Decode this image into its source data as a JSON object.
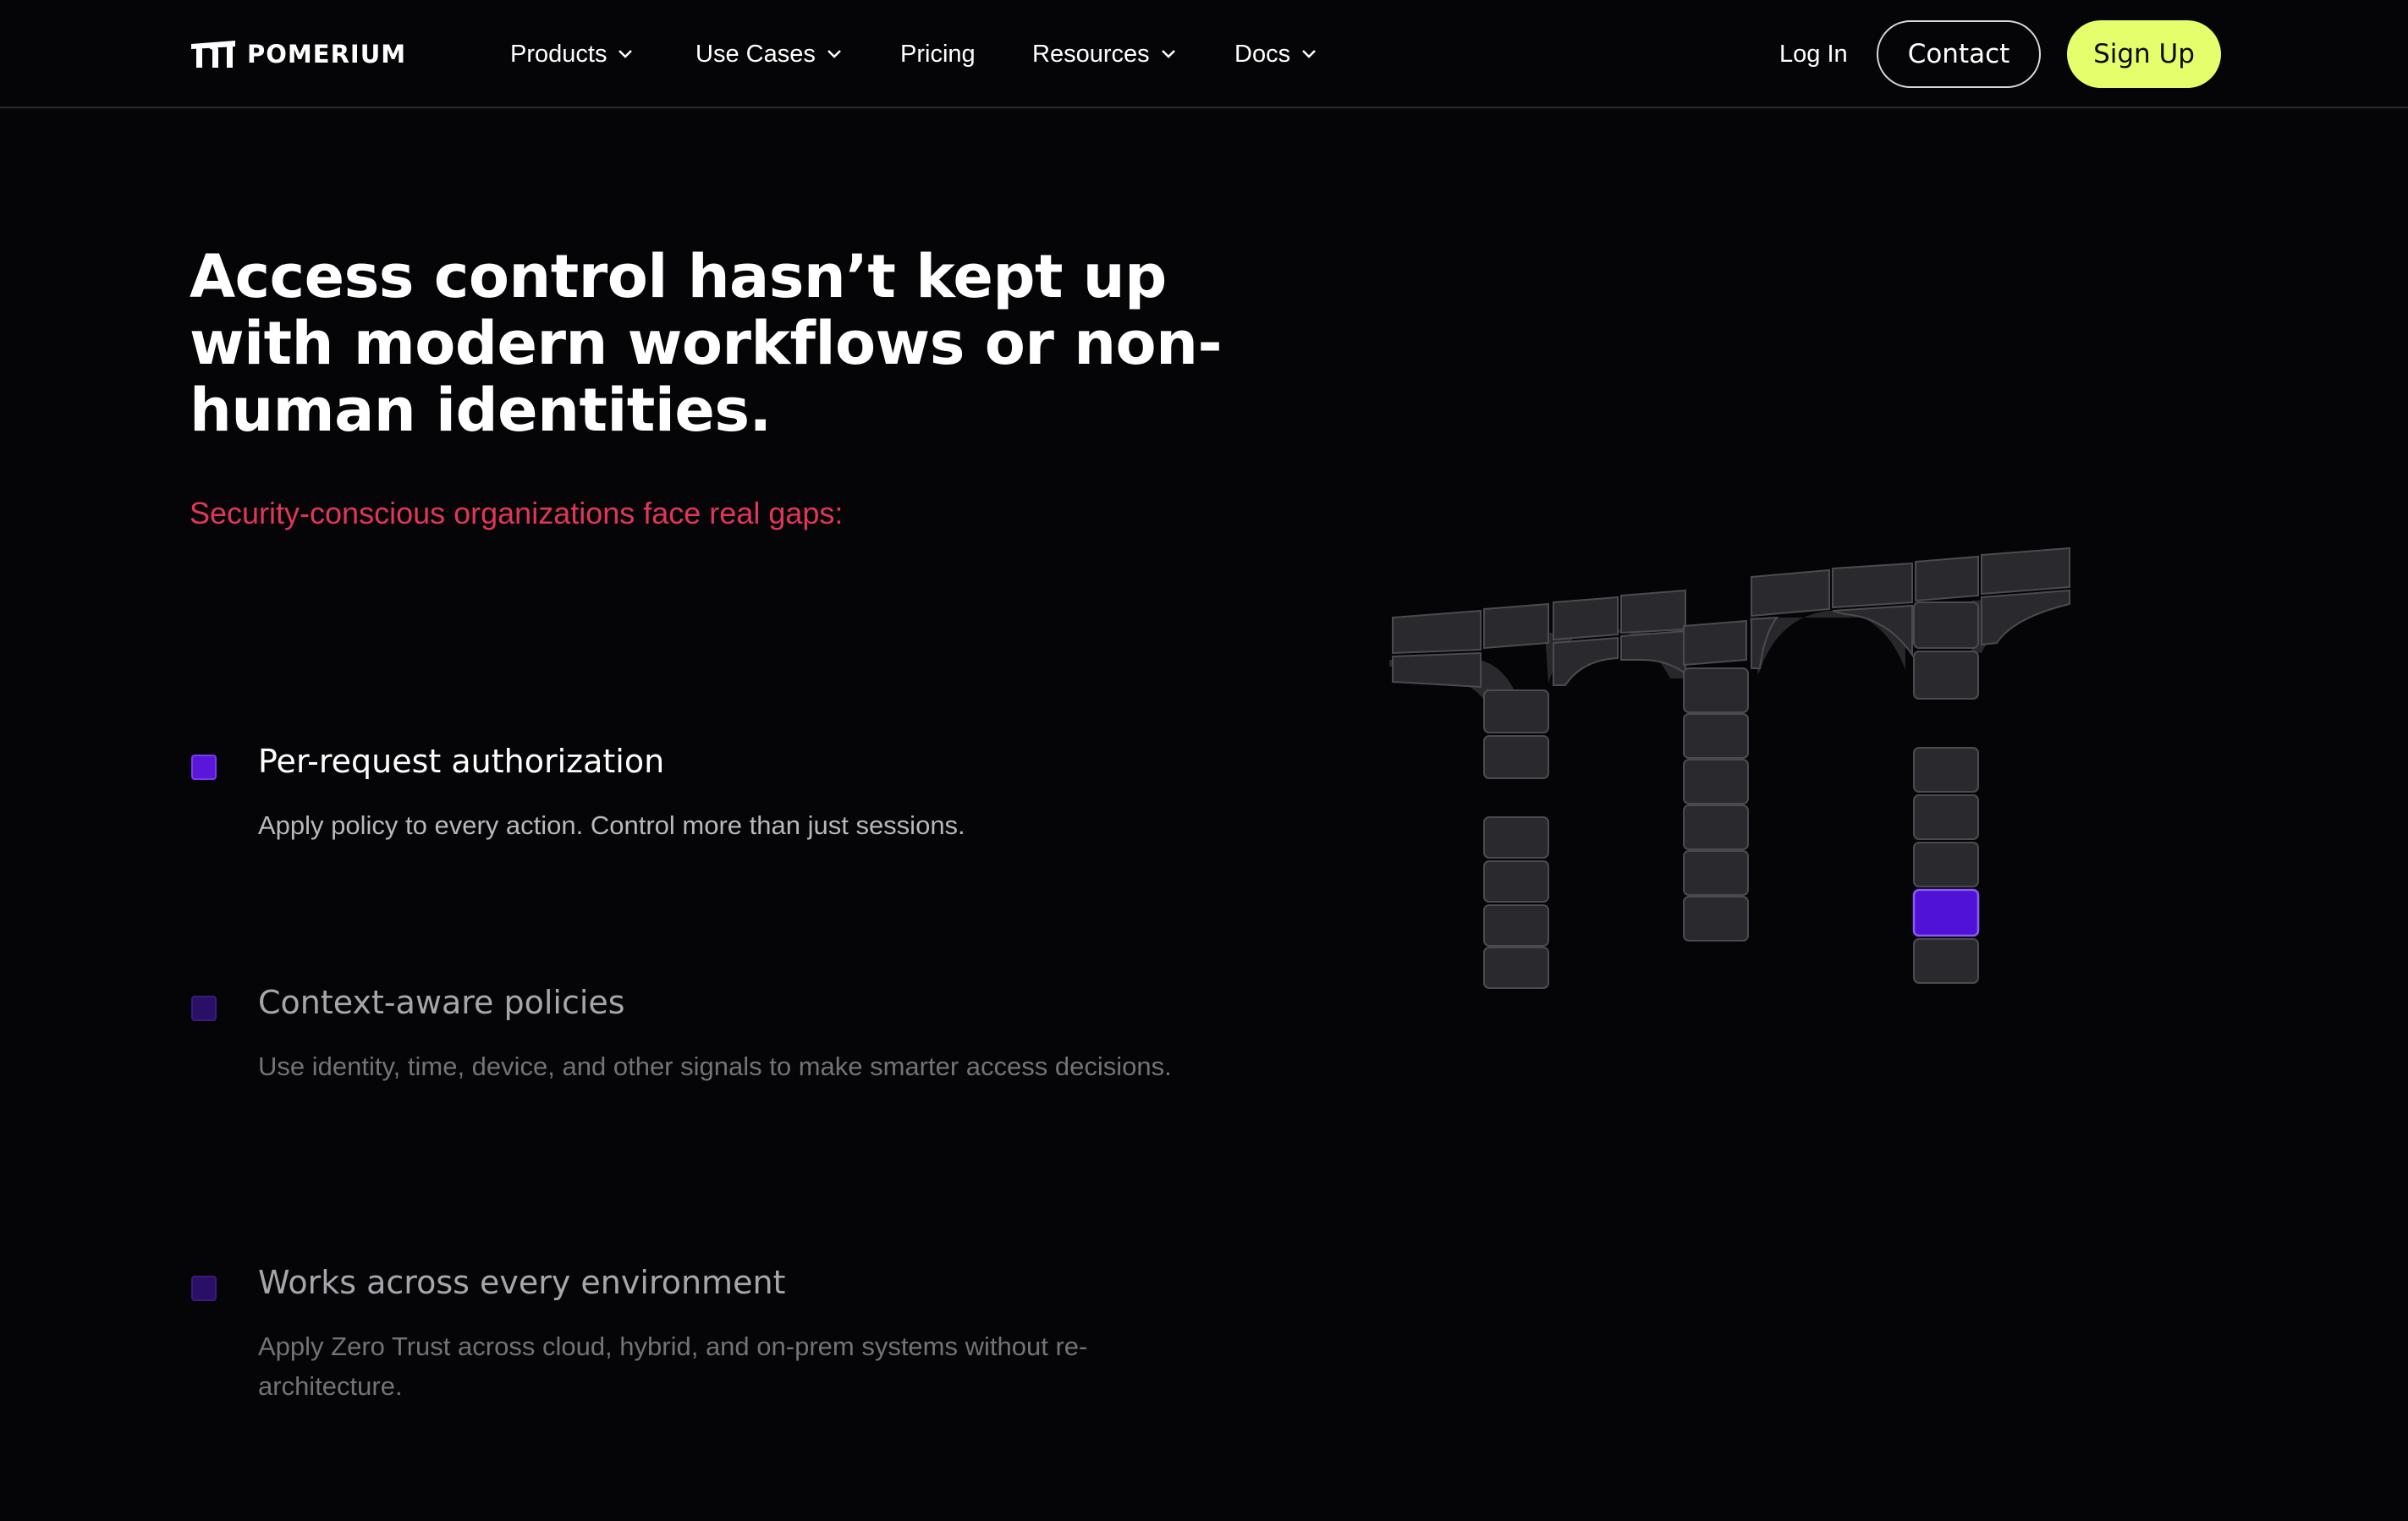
{
  "header": {
    "brand": "POMERIUM",
    "nav": [
      {
        "label": "Products",
        "has_dropdown": true
      },
      {
        "label": "Use Cases",
        "has_dropdown": true
      },
      {
        "label": "Pricing",
        "has_dropdown": false
      },
      {
        "label": "Resources",
        "has_dropdown": true
      },
      {
        "label": "Docs",
        "has_dropdown": true
      }
    ],
    "login_label": "Log In",
    "contact_label": "Contact",
    "signup_label": "Sign Up"
  },
  "hero": {
    "headline": "Access control hasn’t kept up with modern workflows or non-human identities.",
    "subhead": "Security-conscious organizations face real gaps:"
  },
  "features": [
    {
      "title": "Per-request authorization",
      "description": "Apply policy to every action. Control more than just sessions.",
      "active": true
    },
    {
      "title": "Context-aware policies",
      "description": "Use identity, time, device, and other signals to make smarter access decisions.",
      "active": false
    },
    {
      "title": "Works across every environment",
      "description": "Apply Zero Trust across cloud, hybrid, and on-prem systems without re-architecture.",
      "active": false
    }
  ],
  "colors": {
    "background": "#050507",
    "accent_purple": "#5b17d9",
    "signup_lime": "#e4ff6b",
    "subhead_red": "#e0365a"
  },
  "icons": {
    "logo": "pomerium-logo-icon",
    "dropdown": "chevron-down-icon"
  }
}
